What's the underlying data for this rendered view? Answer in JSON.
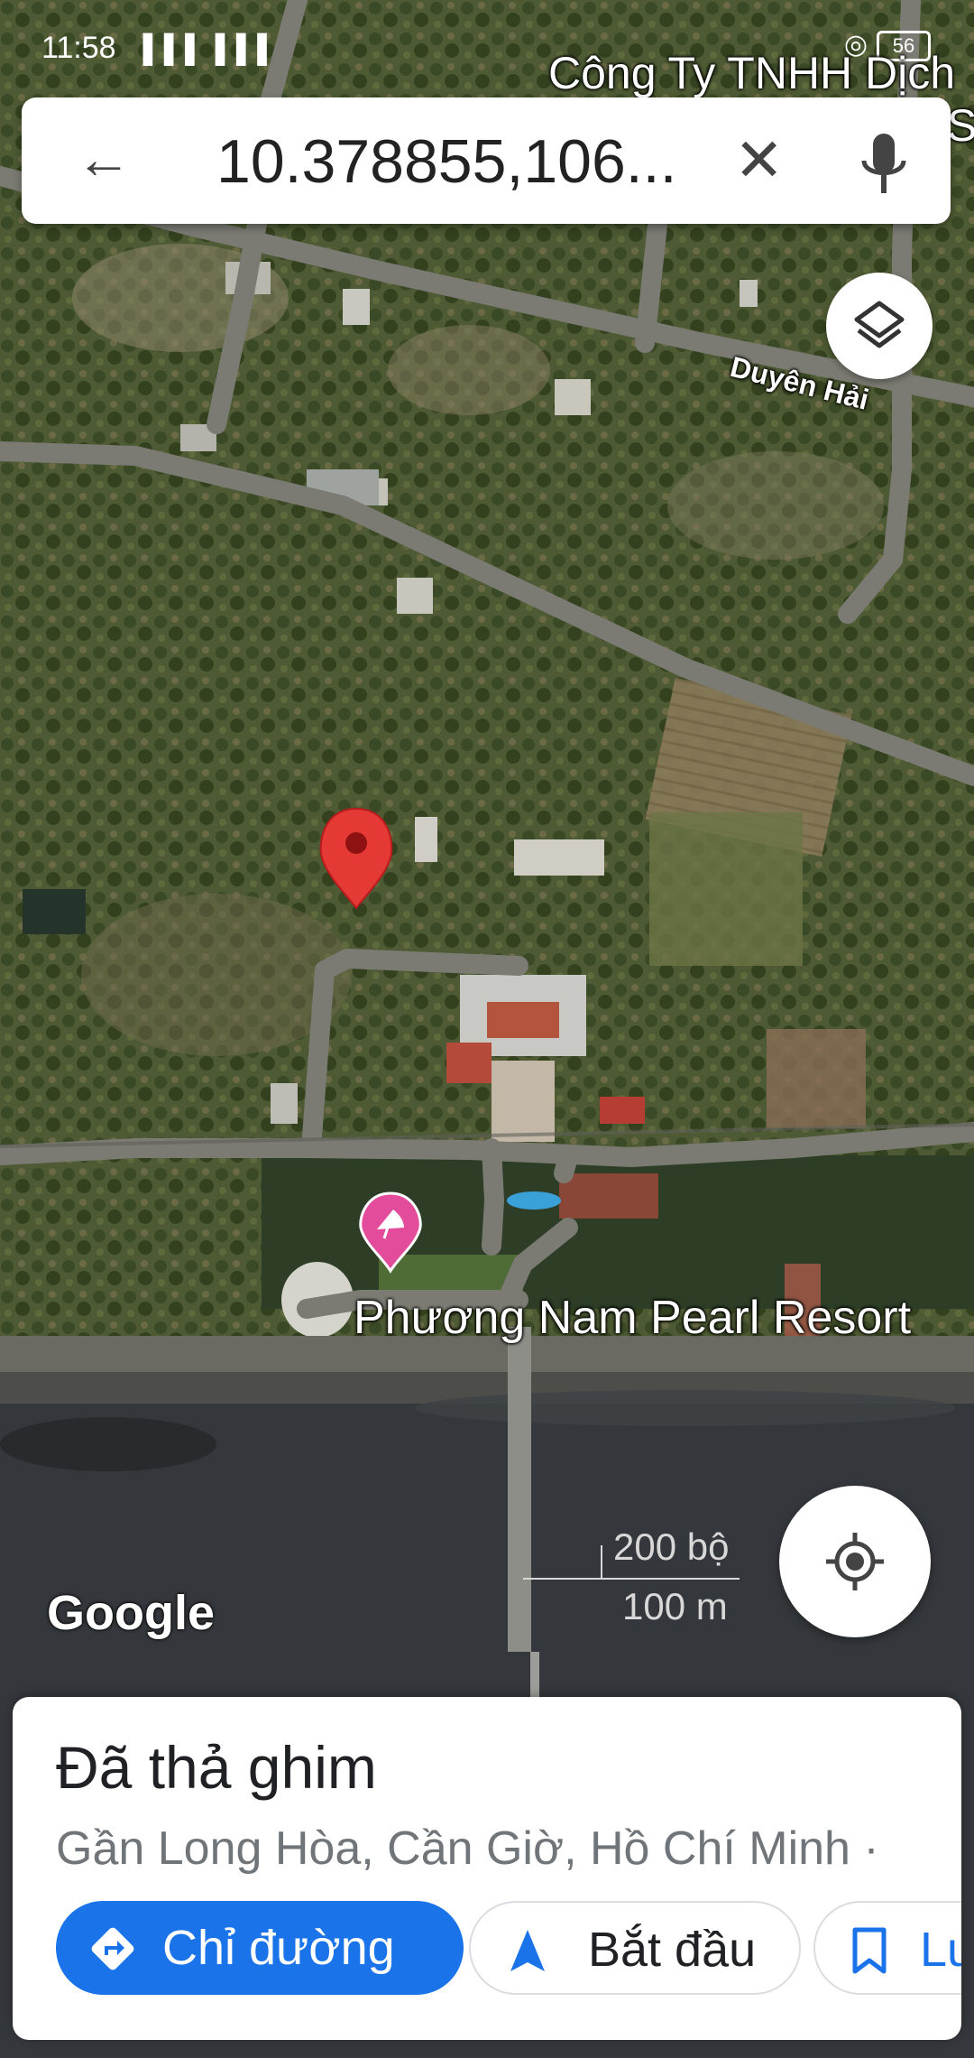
{
  "status_bar": {
    "time": "11:58",
    "signal": "▐▐▐ ▐▐▐",
    "extra": "⋯",
    "battery": "56"
  },
  "search": {
    "query": "10.378855,106..."
  },
  "map_labels": {
    "company": "Công Ty TNHH Dịch",
    "company_line2": "Sa",
    "road": "Duyên Hải",
    "resort": "Phương Nam Pearl Resort",
    "attribution": "Google",
    "scale_imperial": "200 bộ",
    "scale_metric": "100 m"
  },
  "place_sheet": {
    "title": "Đã thả ghim",
    "address": "Gần Long Hòa, Cần Giờ, Hồ Chí Minh ·",
    "directions_label": "Chỉ đường",
    "start_label": "Bắt đầu",
    "save_label": "Lưu"
  },
  "colors": {
    "accent": "#1a73e8",
    "pin": "#e53935",
    "resort_pin": "#e24c9a",
    "road": "#7b7b73",
    "sea": "#33363a"
  },
  "icons": [
    "back-arrow-icon",
    "clear-icon",
    "microphone-icon",
    "layers-icon",
    "dropped-pin-icon",
    "resort-pin-icon",
    "my-location-icon",
    "directions-icon",
    "navigation-icon",
    "bookmark-icon"
  ]
}
